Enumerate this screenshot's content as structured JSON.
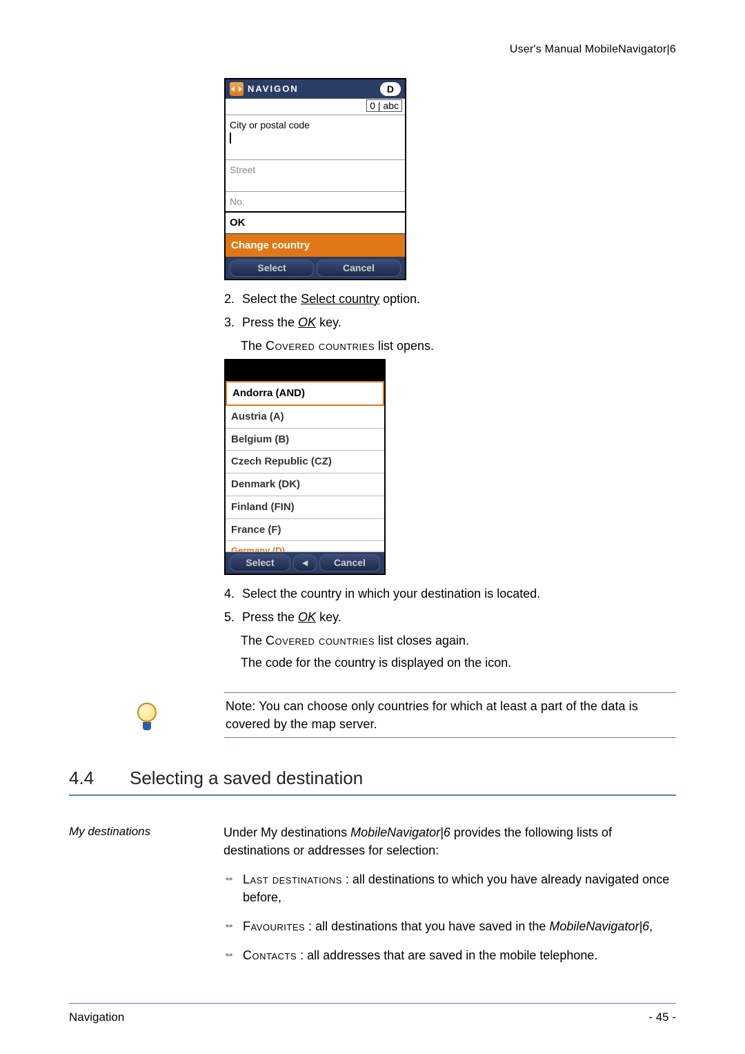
{
  "header": "User's Manual MobileNavigator|6",
  "device1": {
    "brand": "NAVIGON",
    "badge": "D",
    "mode": "0 | abc",
    "field_city_label": "City or postal code",
    "field_street_label": "Street",
    "field_no_label": "No.",
    "ok_label": "OK",
    "change_country_label": "Change country",
    "soft_left": "Select",
    "soft_right": "Cancel"
  },
  "steps_a": {
    "s2_prefix": "2.",
    "s2_text_a": "Select the ",
    "s2_link": "Select country",
    "s2_text_b": " option.",
    "s3_prefix": "3.",
    "s3_text_a": "Press the ",
    "s3_key": "OK",
    "s3_text_b": " key.",
    "after3_a": "The ",
    "after3_sc": "Covered countries",
    "after3_b": "  list opens."
  },
  "device2": {
    "items": [
      "Andorra (AND)",
      "Austria (A)",
      "Belgium (B)",
      "Czech Republic (CZ)",
      "Denmark (DK)",
      "Finland (FIN)",
      "France (F)"
    ],
    "cut_item": "Germany (D)",
    "soft_left": "Select",
    "soft_right": "Cancel"
  },
  "steps_b": {
    "s4_prefix": "4.",
    "s4_text": "Select the country in which your destination is located.",
    "s5_prefix": "5.",
    "s5_text_a": "Press the ",
    "s5_key": "OK",
    "s5_text_b": " key.",
    "after5_a": "The ",
    "after5_sc": "Covered countries",
    "after5_b": "  list closes again.",
    "after5_line2": "The code for the country is displayed on the icon."
  },
  "note": {
    "prefix": "Note:",
    "text": "  You can choose only countries for which at least a part of the data is covered by the map server."
  },
  "section": {
    "num": "4.4",
    "title": "Selecting a saved destination"
  },
  "mydest": {
    "side_label": "My destinations",
    "intro_a": "Under ",
    "intro_ref": "My destinations",
    "intro_space": "    ",
    "intro_product": "MobileNavigator|6",
    "intro_b": " provides the following lists of destinations or addresses for selection:",
    "li1_sc": "Last destinations",
    "li1_rest": "  : all destinations to which you have already navigated once before,",
    "li2_sc": "Favourites",
    "li2_rest": " : all destinations that you have saved in the ",
    "li2_product": "MobileNavigator|6",
    "li2_tail": ",",
    "li3_sc": "Contacts",
    "li3_rest": " : all addresses that are saved in the mobile telephone."
  },
  "footer": {
    "left": "Navigation",
    "right": "- 45 -"
  }
}
